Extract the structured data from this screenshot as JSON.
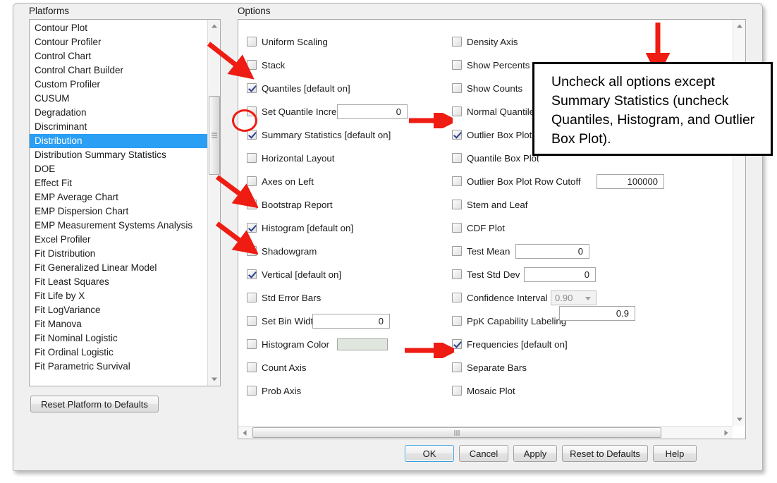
{
  "dialog": {
    "platforms_label": "Platforms",
    "options_label": "Options",
    "reset_platform_label": "Reset Platform to Defaults"
  },
  "platforms": {
    "selected": "Distribution",
    "items": [
      "Contour Plot",
      "Contour Profiler",
      "Control Chart",
      "Control Chart Builder",
      "Custom Profiler",
      "CUSUM",
      "Degradation",
      "Discriminant",
      "Distribution",
      "Distribution Summary Statistics",
      "DOE",
      "Effect Fit",
      "EMP Average Chart",
      "EMP Dispersion Chart",
      "EMP Measurement Systems Analysis",
      "Excel Profiler",
      "Fit Distribution",
      "Fit Generalized Linear Model",
      "Fit Least Squares",
      "Fit Life by X",
      "Fit LogVariance",
      "Fit Manova",
      "Fit Nominal Logistic",
      "Fit Ordinal Logistic",
      "Fit Parametric Survival"
    ]
  },
  "options": {
    "left_column": [
      {
        "label": "Uniform Scaling",
        "checked": false
      },
      {
        "label": "Stack",
        "checked": false
      },
      {
        "label": "Quantiles [default on]",
        "checked": true
      },
      {
        "label": "Set Quantile Increment",
        "checked": false,
        "field": "0"
      },
      {
        "label": "Summary Statistics [default on]",
        "checked": true
      },
      {
        "label": "Horizontal Layout",
        "checked": false
      },
      {
        "label": "Axes on Left",
        "checked": false
      },
      {
        "label": "Bootstrap Report",
        "checked": false
      },
      {
        "label": "Histogram [default on]",
        "checked": true
      },
      {
        "label": "Shadowgram",
        "checked": false
      },
      {
        "label": "Vertical [default on]",
        "checked": true
      },
      {
        "label": "Std Error Bars",
        "checked": false
      },
      {
        "label": "Set Bin Width",
        "checked": false,
        "field": "0"
      },
      {
        "label": "Histogram Color",
        "checked": false,
        "swatch": "#dfe6dd"
      },
      {
        "label": "Count Axis",
        "checked": false
      },
      {
        "label": "Prob Axis",
        "checked": false
      }
    ],
    "right_column": [
      {
        "label": "Density Axis",
        "checked": false
      },
      {
        "label": "Show Percents",
        "checked": false
      },
      {
        "label": "Show Counts",
        "checked": false
      },
      {
        "label": "Normal Quantile Plot",
        "checked": false
      },
      {
        "label": "Outlier Box Plot",
        "checked": true
      },
      {
        "label": "Quantile Box Plot",
        "checked": false
      },
      {
        "label": "Outlier Box Plot Row Cutoff",
        "checked": false,
        "field": "100000"
      },
      {
        "label": "Stem and Leaf",
        "checked": false
      },
      {
        "label": "CDF Plot",
        "checked": false
      },
      {
        "label": "Test Mean",
        "checked": false,
        "field": "0"
      },
      {
        "label": "Test Std Dev",
        "checked": false,
        "field": "0"
      },
      {
        "label": "Confidence Interval",
        "checked": false,
        "combo": "0.90",
        "field2": "0.9"
      },
      {
        "label": "PpK Capability Labeling",
        "checked": false
      },
      {
        "label": "Frequencies [default on]",
        "checked": true
      },
      {
        "label": "Separate Bars",
        "checked": false
      },
      {
        "label": "Mosaic Plot",
        "checked": false
      }
    ]
  },
  "buttons": {
    "ok": "OK",
    "cancel": "Cancel",
    "apply": "Apply",
    "reset_to_defaults": "Reset to Defaults",
    "help": "Help"
  },
  "annotation": {
    "callout_text": "Uncheck all options except Summary Statistics (uncheck Quantiles, Histogram, and Outlier Box Plot).",
    "accent_color": "#ee1c12"
  }
}
